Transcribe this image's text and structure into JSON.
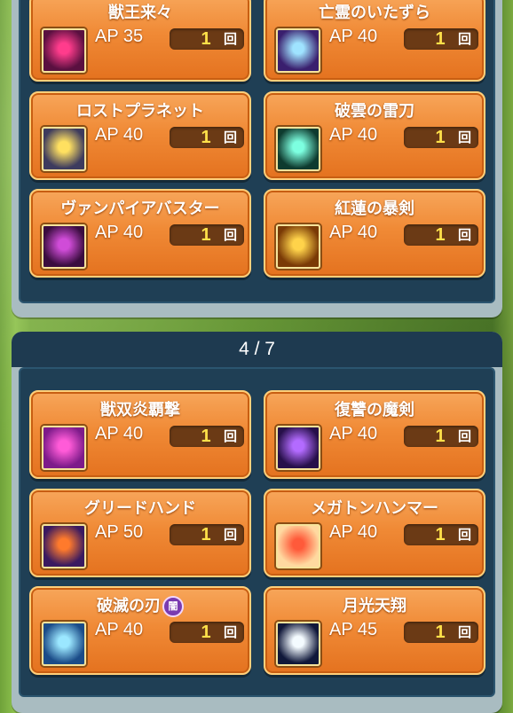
{
  "pages": [
    {
      "cards": [
        {
          "title": "獣王来々",
          "ap": "AP 35",
          "count": "1",
          "unit": "回",
          "icon": "crimson-lattice-icon",
          "colors": [
            "#ff3c8c",
            "#5a1040"
          ]
        },
        {
          "title": "亡霊のいたずら",
          "ap": "AP 40",
          "count": "1",
          "unit": "回",
          "icon": "ghost-skull-icon",
          "colors": [
            "#9fe3ff",
            "#3a1f6e"
          ]
        },
        {
          "title": "ロストプラネット",
          "ap": "AP 40",
          "count": "1",
          "unit": "回",
          "icon": "starburst-icon",
          "colors": [
            "#ffe060",
            "#3d3b5e"
          ]
        },
        {
          "title": "破雲の雷刀",
          "ap": "AP 40",
          "count": "1",
          "unit": "回",
          "icon": "lightning-blade-icon",
          "colors": [
            "#7dffe0",
            "#0e3b2f"
          ]
        },
        {
          "title": "ヴァンパイアバスター",
          "ap": "AP 40",
          "count": "1",
          "unit": "回",
          "icon": "purple-cross-icon",
          "colors": [
            "#d04cd8",
            "#3a0d3f"
          ]
        },
        {
          "title": "紅蓮の暴剣",
          "ap": "AP 40",
          "count": "1",
          "unit": "回",
          "icon": "flame-sword-icon",
          "colors": [
            "#ffd34a",
            "#7a3a06"
          ]
        }
      ]
    },
    {
      "header": "4 / 7",
      "cards": [
        {
          "title": "獣双炎覇撃",
          "ap": "AP 40",
          "count": "1",
          "unit": "回",
          "icon": "pink-slash-icon",
          "colors": [
            "#ff5bd8",
            "#7d1b8a"
          ]
        },
        {
          "title": "復讐の魔剣",
          "ap": "AP 40",
          "count": "1",
          "unit": "回",
          "icon": "violet-blade-icon",
          "colors": [
            "#b36bff",
            "#27104a"
          ]
        },
        {
          "title": "グリードハンド",
          "ap": "AP 50",
          "count": "1",
          "unit": "回",
          "icon": "greed-hand-icon",
          "colors": [
            "#ff7a2c",
            "#3a1a60"
          ]
        },
        {
          "title": "メガトンハンマー",
          "ap": "AP 40",
          "count": "1",
          "unit": "回",
          "icon": "hammer-icon",
          "colors": [
            "#ff5a3a",
            "#ffd9a0"
          ]
        },
        {
          "title": "破滅の刃",
          "badge": "闇",
          "ap": "AP 40",
          "count": "1",
          "unit": "回",
          "icon": "dark-blade-icon",
          "colors": [
            "#9be7ff",
            "#1b4c88"
          ]
        },
        {
          "title": "月光天翔",
          "ap": "AP 45",
          "count": "1",
          "unit": "回",
          "icon": "moonlight-icon",
          "colors": [
            "#f4fbff",
            "#10183a"
          ]
        }
      ]
    }
  ]
}
